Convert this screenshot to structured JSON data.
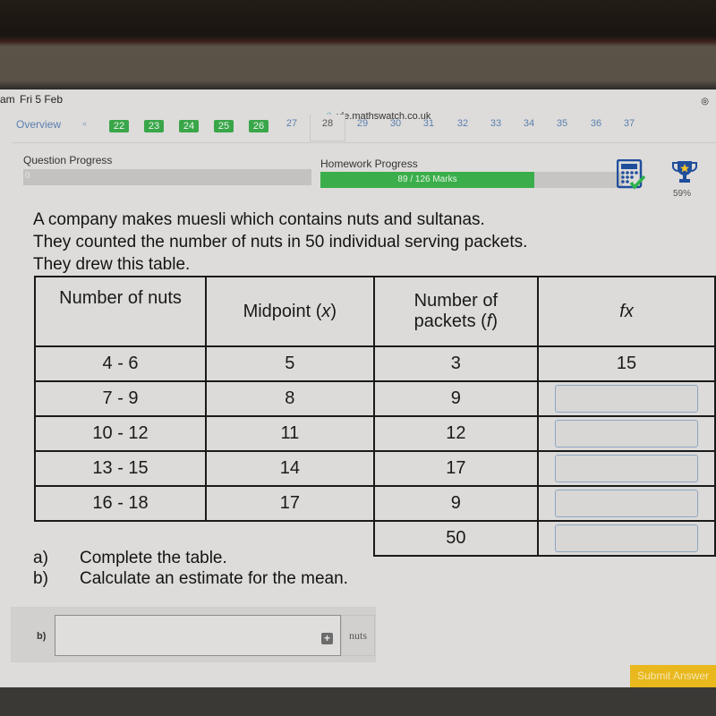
{
  "status_bar": {
    "time_fragment": "am",
    "date": "Fri 5 Feb",
    "url": "vle.mathswatch.co.uk"
  },
  "pager": {
    "overview_label": "Overview",
    "prev_label": "«",
    "pages": [
      {
        "num": "22",
        "state": "done"
      },
      {
        "num": "23",
        "state": "done"
      },
      {
        "num": "24",
        "state": "done"
      },
      {
        "num": "25",
        "state": "done"
      },
      {
        "num": "26",
        "state": "done"
      },
      {
        "num": "27",
        "state": "todo"
      },
      {
        "num": "28",
        "state": "current"
      },
      {
        "num": "29",
        "state": "todo"
      },
      {
        "num": "30",
        "state": "todo"
      },
      {
        "num": "31",
        "state": "todo"
      },
      {
        "num": "32",
        "state": "todo"
      },
      {
        "num": "33",
        "state": "todo"
      },
      {
        "num": "34",
        "state": "todo"
      },
      {
        "num": "35",
        "state": "todo"
      },
      {
        "num": "36",
        "state": "todo"
      },
      {
        "num": "37",
        "state": "todo"
      }
    ]
  },
  "progress": {
    "question_label": "Question Progress",
    "question_value": "0",
    "homework_label": "Homework Progress",
    "homework_text": "89 / 126 Marks",
    "homework_fraction": 0.706,
    "trophy_percent": "59%",
    "colors": {
      "fill": "#3aae4a",
      "trophy": "#1f4e9c",
      "star": "#f2c230",
      "check": "#2db34a"
    }
  },
  "question": {
    "lines": [
      "A company makes muesli which contains nuts and sultanas.",
      "They counted the number of nuts in 50 individual serving packets.",
      "They drew this table."
    ]
  },
  "table": {
    "headers": {
      "col1": "Number of nuts",
      "col2_text": "Midpoint (",
      "col2_var": "x",
      "col2_close": ")",
      "col3_line1": "Number of",
      "col3_text": "packets (",
      "col3_var": "f",
      "col3_close": ")",
      "col4": "fx"
    },
    "rows": [
      {
        "range": "4 - 6",
        "midpoint": "5",
        "frequency": "3",
        "fx": "15"
      },
      {
        "range": "7 - 9",
        "midpoint": "8",
        "frequency": "9",
        "fx": ""
      },
      {
        "range": "10 - 12",
        "midpoint": "11",
        "frequency": "12",
        "fx": ""
      },
      {
        "range": "13 - 15",
        "midpoint": "14",
        "frequency": "17",
        "fx": ""
      },
      {
        "range": "16 - 18",
        "midpoint": "17",
        "frequency": "9",
        "fx": ""
      }
    ],
    "total_frequency": "50",
    "total_fx": ""
  },
  "parts": [
    {
      "label": "a)",
      "text": "Complete the table."
    },
    {
      "label": "b)",
      "text": "Calculate an estimate for the mean."
    }
  ],
  "answer": {
    "label": "b)",
    "value": "",
    "unit": "nuts",
    "plus_symbol": "+"
  },
  "submit_label": "Submit Answer"
}
